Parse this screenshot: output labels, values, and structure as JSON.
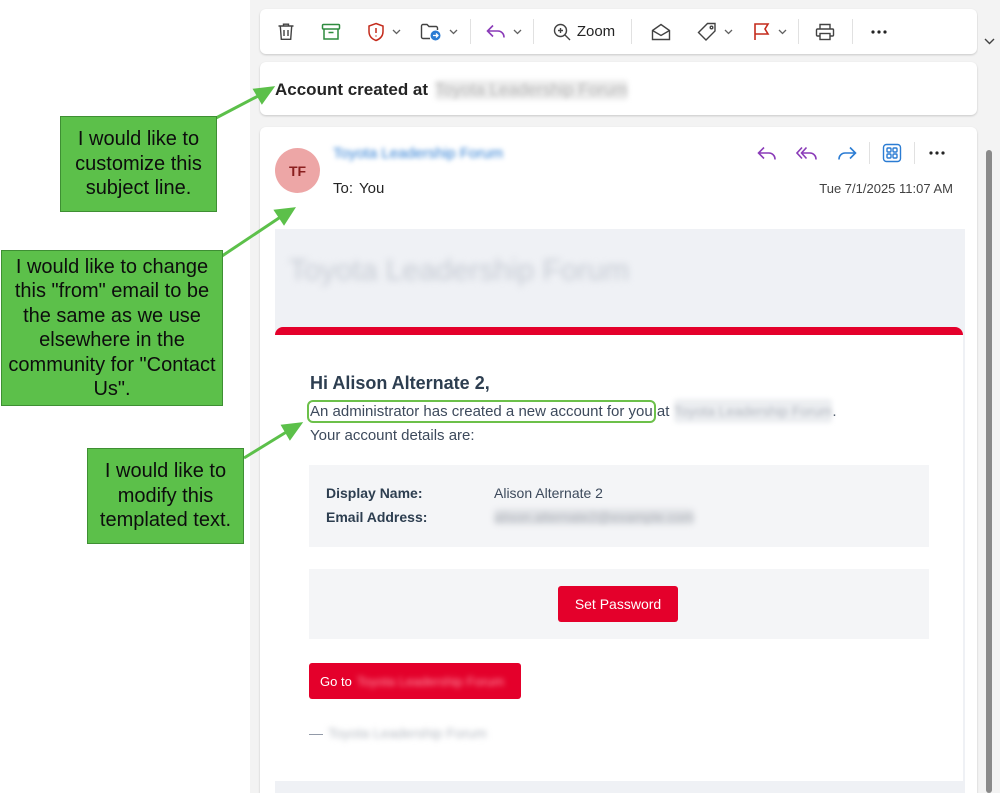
{
  "toolbar": {
    "zoom_label": "Zoom",
    "icons": [
      "trash-icon",
      "archive-icon",
      "report-shield-icon",
      "move-folder-icon",
      "reply-icon",
      "zoom-icon",
      "envelope-open-icon",
      "tag-icon",
      "flag-icon",
      "print-icon",
      "more-icon"
    ]
  },
  "subject": {
    "title": "Account created at",
    "redacted_text": "Toyota Leadership Forum"
  },
  "message": {
    "avatar_initials": "TF",
    "sender_name": "Toyota Leadership Forum",
    "to_label": "To:",
    "to_value": "You",
    "date": "Tue 7/1/2025 11:07 AM",
    "actions": [
      "reply-icon",
      "reply-all-icon",
      "forward-icon",
      "apps-icon",
      "more-icon"
    ]
  },
  "template": {
    "header_title": "Toyota Leadership Forum",
    "greeting": "Hi Alison Alternate 2,",
    "intro_highlighted": "An administrator has created a new account for you",
    "intro_at": "at",
    "community_name": "Toyota Leadership Forum",
    "intro_end": ".",
    "intro_line2": "Your account details are:",
    "details": {
      "display_name_label": "Display Name:",
      "display_name_value": "Alison Alternate 2",
      "email_label": "Email Address:",
      "email_value": "alison.alternate2@example.com"
    },
    "set_password_label": "Set Password",
    "goto_prefix": "Go to",
    "goto_target": "Toyota Leadership Forum",
    "signoff_dash": "—",
    "signoff_name": "Toyota Leadership Forum"
  },
  "annotations": {
    "subject_note": "I would like to customize this subject line.",
    "from_note": "I would like to change this \"from\" email to be the same as we use elsewhere in the community for \"Contact Us\".",
    "template_note": "I would like to modify this templated text."
  },
  "colors": {
    "accent_red": "#e4002b",
    "annotation_green": "#5cc04a",
    "avatar_bg": "#eda6a6",
    "reply_purple": "#8a3bb8",
    "forward_blue": "#2b7cd3"
  }
}
